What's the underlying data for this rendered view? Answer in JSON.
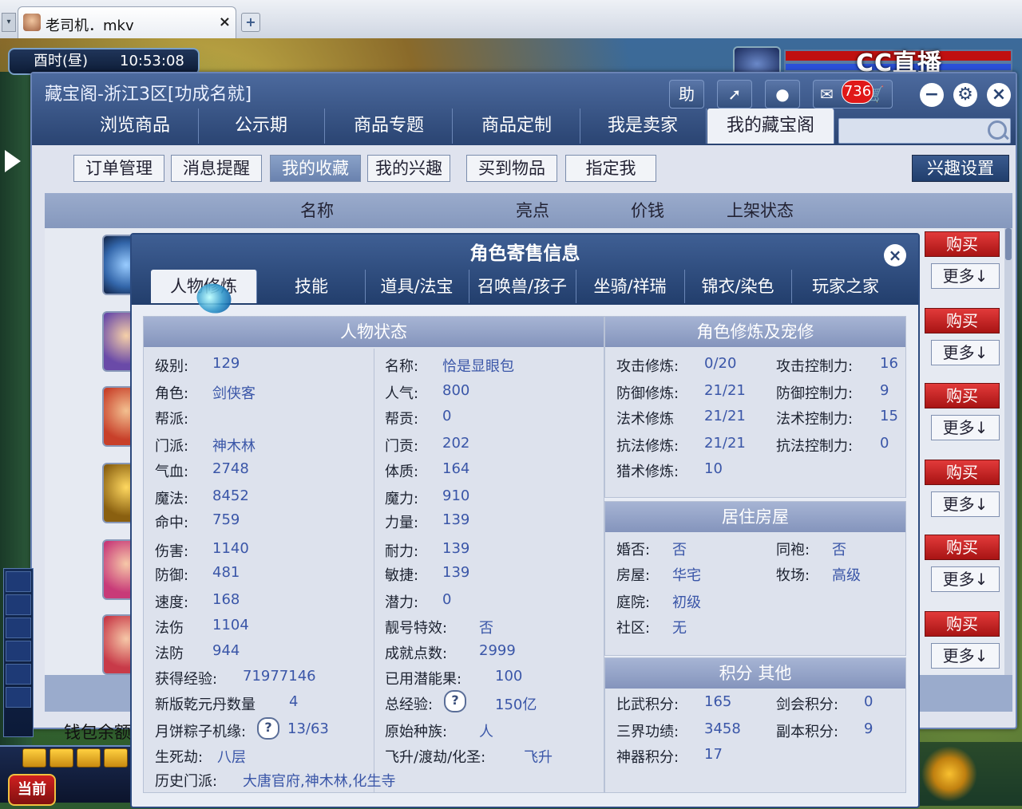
{
  "tabbar": {
    "title": "老司机．mkv",
    "close": "×",
    "new_tab": "+"
  },
  "hud": {
    "time_period": "酉时(昼)",
    "clock": "10:53:08",
    "cc_logo": "CC直播",
    "current_btn": "当前"
  },
  "window": {
    "title": "藏宝阁-浙江3区[功成名就]",
    "help": "助",
    "badge_count": "736",
    "main_tabs": [
      "浏览商品",
      "公示期",
      "商品专题",
      "商品定制",
      "我是卖家",
      "我的藏宝阁"
    ],
    "sub_tabs": [
      "订单管理",
      "消息提醒",
      "我的收藏",
      "我的兴趣",
      "买到物品",
      "指定我"
    ],
    "interest_settings": "兴趣设置",
    "list_headers": [
      "名称",
      "亮点",
      "价钱",
      "上架状态"
    ],
    "buy_label": "购买",
    "more_label": "更多↓",
    "wallet_label": "钱包余额"
  },
  "dialog": {
    "title": "角色寄售信息",
    "tabs": [
      "人物修炼",
      "技能",
      "道具/法宝",
      "召唤兽/孩子",
      "坐骑/祥瑞",
      "锦衣/染色",
      "玩家之家"
    ],
    "status": {
      "title": "人物状态",
      "col1": [
        {
          "label": "级别:",
          "value": "129"
        },
        {
          "label": "角色:",
          "value": "剑侠客"
        },
        {
          "label": "帮派:",
          "value": ""
        },
        {
          "label": "门派:",
          "value": "神木林"
        },
        {
          "label": "气血:",
          "value": "2748"
        },
        {
          "label": "魔法:",
          "value": "8452"
        },
        {
          "label": "命中:",
          "value": "759"
        },
        {
          "label": "伤害:",
          "value": "1140"
        },
        {
          "label": "防御:",
          "value": "481"
        },
        {
          "label": "速度:",
          "value": "168"
        },
        {
          "label": "法伤",
          "value": "1104"
        },
        {
          "label": "法防",
          "value": "944"
        },
        {
          "label": "获得经验:",
          "value": "71977146"
        },
        {
          "label": "新版乾元丹数量",
          "value": "4"
        },
        {
          "label": "月饼粽子机缘:",
          "value": "13/63"
        },
        {
          "label": "生死劫:",
          "value": "八层"
        },
        {
          "label": "历史门派:",
          "value": "大唐官府,神木林,化生寺"
        }
      ],
      "col2": [
        {
          "label": "名称:",
          "value": "恰是显眼包"
        },
        {
          "label": "人气:",
          "value": "800"
        },
        {
          "label": "帮贡:",
          "value": "0"
        },
        {
          "label": "门贡:",
          "value": "202"
        },
        {
          "label": "体质:",
          "value": "164"
        },
        {
          "label": "魔力:",
          "value": "910"
        },
        {
          "label": "力量:",
          "value": "139"
        },
        {
          "label": "耐力:",
          "value": "139"
        },
        {
          "label": "敏捷:",
          "value": "139"
        },
        {
          "label": "潜力:",
          "value": "0"
        },
        {
          "label": "靓号特效:",
          "value": "否"
        },
        {
          "label": "成就点数:",
          "value": "2999"
        },
        {
          "label": "已用潜能果:",
          "value": "100"
        },
        {
          "label": "总经验:",
          "value": "150亿"
        },
        {
          "label": "原始种族:",
          "value": "人"
        },
        {
          "label": "飞升/渡劫/化圣:",
          "value": "飞升"
        }
      ]
    },
    "cultivation": {
      "title": "角色修炼及宠修",
      "left": [
        {
          "label": "攻击修炼:",
          "value": "0/20"
        },
        {
          "label": "防御修炼:",
          "value": "21/21"
        },
        {
          "label": "法术修炼",
          "value": "21/21"
        },
        {
          "label": "抗法修炼:",
          "value": "21/21"
        },
        {
          "label": "猎术修炼:",
          "value": "10"
        }
      ],
      "right": [
        {
          "label": "攻击控制力:",
          "value": "16"
        },
        {
          "label": "防御控制力:",
          "value": "9"
        },
        {
          "label": "法术控制力:",
          "value": "15"
        },
        {
          "label": "抗法控制力:",
          "value": "0"
        }
      ]
    },
    "housing": {
      "title": "居住房屋",
      "left": [
        {
          "label": "婚否:",
          "value": "否"
        },
        {
          "label": "房屋:",
          "value": "华宅"
        },
        {
          "label": "庭院:",
          "value": "初级"
        },
        {
          "label": "社区:",
          "value": "无"
        }
      ],
      "right": [
        {
          "label": "同袍:",
          "value": "否"
        },
        {
          "label": "牧场:",
          "value": "高级"
        }
      ]
    },
    "points": {
      "title": "积分 其他",
      "left": [
        {
          "label": "比武积分:",
          "value": "165"
        },
        {
          "label": "三界功绩:",
          "value": "3458"
        },
        {
          "label": "神器积分:",
          "value": "17"
        }
      ],
      "right": [
        {
          "label": "剑会积分:",
          "value": "0"
        },
        {
          "label": "副本积分:",
          "value": "9"
        }
      ]
    }
  },
  "colors": {
    "accent": "#2a4472",
    "value_blue": "#3a56a8",
    "buy_red": "#c81e1e"
  },
  "icons": [
    "help-icon",
    "share-icon",
    "record-icon",
    "chat-icon",
    "cart-icon",
    "minimize-icon",
    "settings-icon",
    "close-icon",
    "search-icon",
    "question-icon"
  ]
}
